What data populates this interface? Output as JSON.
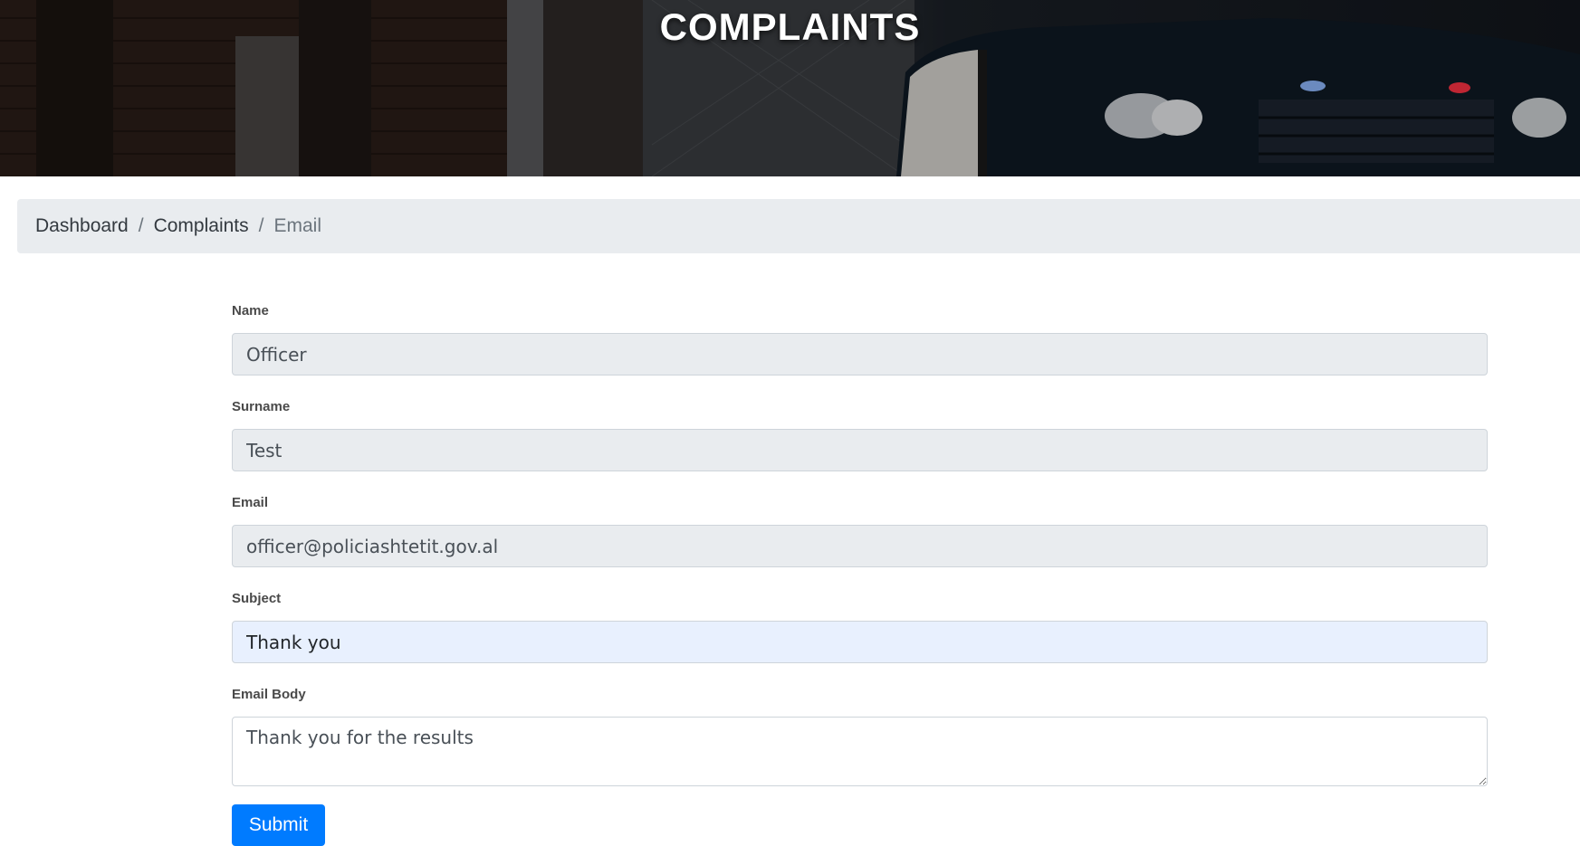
{
  "header": {
    "title": "COMPLAINTS"
  },
  "breadcrumb": {
    "items": [
      {
        "label": "Dashboard"
      },
      {
        "label": "Complaints"
      }
    ],
    "current": "Email",
    "separator": "/"
  },
  "form": {
    "name": {
      "label": "Name",
      "value": "Officer"
    },
    "surname": {
      "label": "Surname",
      "value": "Test"
    },
    "email": {
      "label": "Email",
      "value": "officer@policiashtetit.gov.al"
    },
    "subject": {
      "label": "Subject",
      "value": "Thank you"
    },
    "body": {
      "label": "Email Body",
      "value": "Thank you for the results"
    },
    "submit_label": "Submit"
  },
  "colors": {
    "primary_button": "#007bff",
    "breadcrumb_bg": "#e9ecef",
    "readonly_field_bg": "#e9ecef",
    "autofill_field_bg": "#e8f0fe"
  }
}
